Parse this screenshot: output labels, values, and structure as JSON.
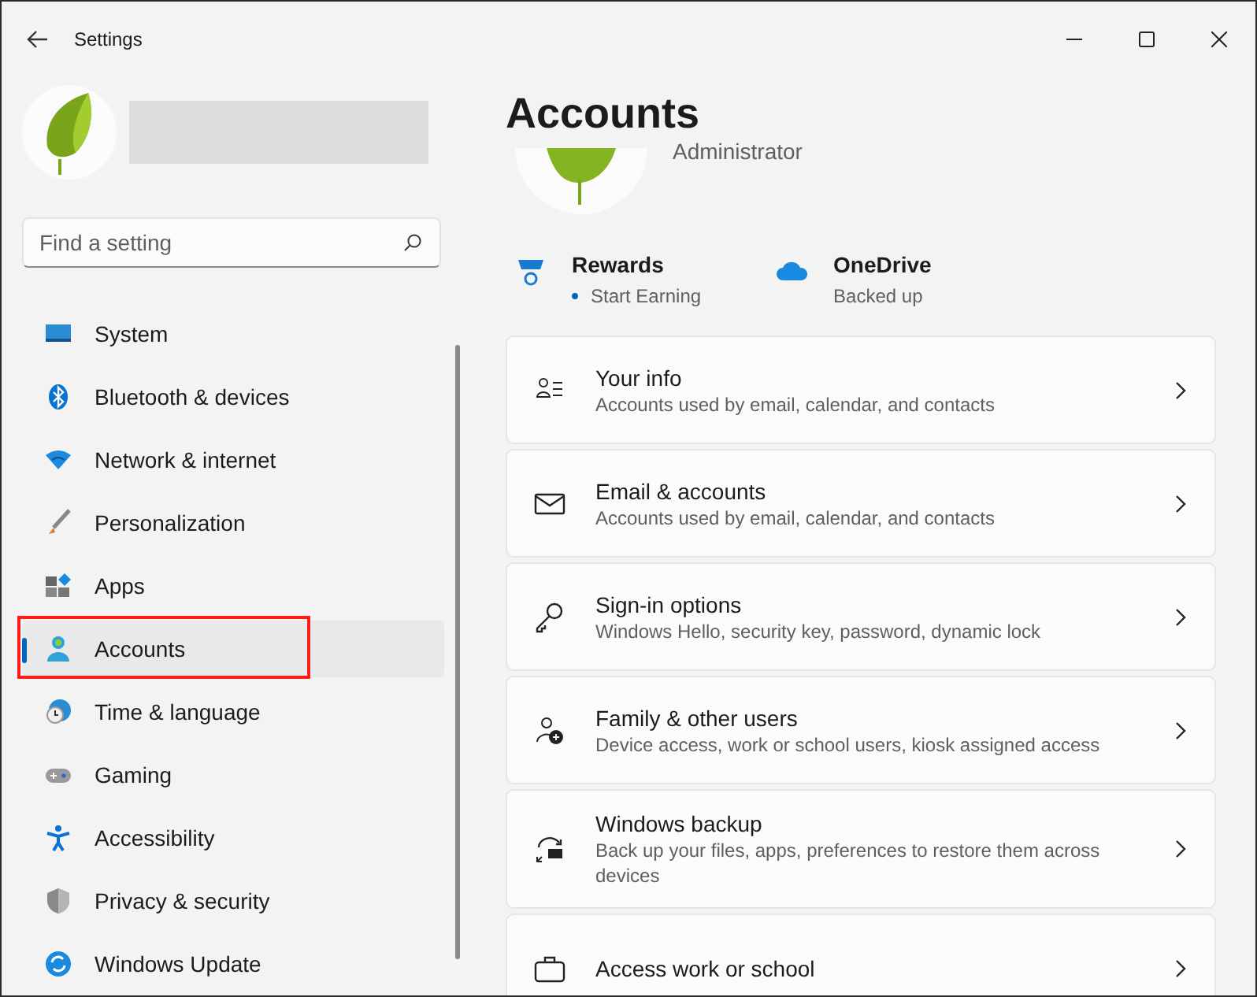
{
  "window": {
    "title": "Settings"
  },
  "search": {
    "placeholder": "Find a setting"
  },
  "sidebar": {
    "items": [
      {
        "label": "System",
        "selected": false,
        "highlighted": false
      },
      {
        "label": "Bluetooth & devices",
        "selected": false,
        "highlighted": false
      },
      {
        "label": "Network & internet",
        "selected": false,
        "highlighted": false
      },
      {
        "label": "Personalization",
        "selected": false,
        "highlighted": false
      },
      {
        "label": "Apps",
        "selected": false,
        "highlighted": false
      },
      {
        "label": "Accounts",
        "selected": true,
        "highlighted": true
      },
      {
        "label": "Time & language",
        "selected": false,
        "highlighted": false
      },
      {
        "label": "Gaming",
        "selected": false,
        "highlighted": false
      },
      {
        "label": "Accessibility",
        "selected": false,
        "highlighted": false
      },
      {
        "label": "Privacy & security",
        "selected": false,
        "highlighted": false
      },
      {
        "label": "Windows Update",
        "selected": false,
        "highlighted": false
      }
    ]
  },
  "page": {
    "title": "Accounts",
    "account_role": "Administrator",
    "services": [
      {
        "name": "Rewards",
        "status": "Start Earning",
        "bullet": true
      },
      {
        "name": "OneDrive",
        "status": "Backed up",
        "bullet": false
      }
    ],
    "cards": [
      {
        "title": "Your info",
        "subtitle": "Accounts used by email, calendar, and contacts"
      },
      {
        "title": "Email & accounts",
        "subtitle": "Accounts used by email, calendar, and contacts"
      },
      {
        "title": "Sign-in options",
        "subtitle": "Windows Hello, security key, password, dynamic lock"
      },
      {
        "title": "Family & other users",
        "subtitle": "Device access, work or school users, kiosk assigned access"
      },
      {
        "title": "Windows backup",
        "subtitle": "Back up your files, apps, preferences to restore them across devices"
      },
      {
        "title": "Access work or school"
      }
    ]
  }
}
